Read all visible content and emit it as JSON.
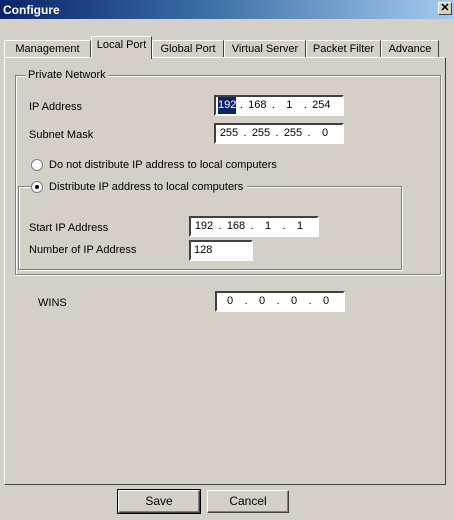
{
  "window": {
    "title": "Configure",
    "close_glyph": "✕"
  },
  "tabs": [
    {
      "label": "Management",
      "active": false
    },
    {
      "label": "Local Port",
      "active": true
    },
    {
      "label": "Global Port",
      "active": false
    },
    {
      "label": "Virtual Server",
      "active": false
    },
    {
      "label": "Packet Filter",
      "active": false
    },
    {
      "label": "Advance",
      "active": false
    }
  ],
  "private_network": {
    "group_label": "Private Network",
    "ip_address": {
      "label": "IP Address",
      "octets": [
        "192",
        "168",
        "1",
        "254"
      ],
      "selected_octet": 0
    },
    "subnet_mask": {
      "label": "Subnet Mask",
      "octets": [
        "255",
        "255",
        "255",
        "0"
      ]
    },
    "radio_no_distribute": {
      "label": "Do not distribute IP address to local computers",
      "checked": false
    },
    "radio_distribute": {
      "label": "Distribute IP address to local computers",
      "checked": true
    },
    "start_ip": {
      "label": "Start IP Address",
      "octets": [
        "192",
        "168",
        "1",
        "1"
      ]
    },
    "number_of_ip": {
      "label": "Number of IP Address",
      "value": "128"
    }
  },
  "wins": {
    "label": "WINS",
    "octets": [
      "0",
      "0",
      "0",
      "0"
    ]
  },
  "buttons": {
    "save": "Save",
    "cancel": "Cancel"
  },
  "colors": {
    "dialog_bg": "#d4d0c8",
    "title_bar": "#0a246a",
    "selection": "#0a246a"
  }
}
